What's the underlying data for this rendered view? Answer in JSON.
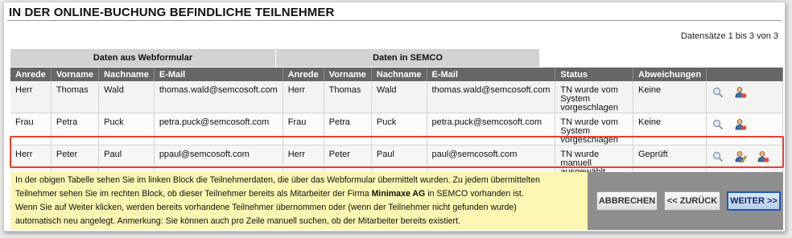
{
  "title": "IN DER ONLINE-BUCHUNG BEFINDLICHE TEILNEHMER",
  "records_info": "Datensätze 1 bis 3 von 3",
  "groups": {
    "webform": "Daten aus Webformular",
    "semco": "Daten in SEMCO"
  },
  "columns": [
    "Anrede",
    "Vorname",
    "Nachname",
    "E-Mail",
    "Anrede",
    "Vorname",
    "Nachname",
    "E-Mail",
    "Status",
    "Abweichungen",
    ""
  ],
  "rows": [
    {
      "web_anrede": "Herr",
      "web_vorname": "Thomas",
      "web_nachname": "Wald",
      "web_email": "thomas.wald@semcosoft.com",
      "semco_anrede": "Herr",
      "semco_vorname": "Thomas",
      "semco_nachname": "Wald",
      "semco_email": "thomas.wald@semcosoft.com",
      "status": "TN wurde vom System vorgeschlagen",
      "abweichungen": "Keine",
      "actions": [
        "magnifier-icon",
        "user-icon"
      ]
    },
    {
      "web_anrede": "Frau",
      "web_vorname": "Petra",
      "web_nachname": "Puck",
      "web_email": "petra.puck@semcosoft.com",
      "semco_anrede": "Frau",
      "semco_vorname": "Petra",
      "semco_nachname": "Puck",
      "semco_email": "petra.puck@semcosoft.com",
      "status": "TN wurde vom System vorgeschlagen",
      "abweichungen": "Keine",
      "actions": [
        "magnifier-icon",
        "user-icon"
      ]
    },
    {
      "web_anrede": "Herr",
      "web_vorname": "Peter",
      "web_nachname": "Paul",
      "web_email": "ppaul@semcosoft.com",
      "semco_anrede": "Herr",
      "semco_vorname": "Peter",
      "semco_nachname": "Paul",
      "semco_email": "paul@semcosoft.com",
      "status": "TN wurde manuell ausgewählt",
      "abweichungen": "Geprüft",
      "actions": [
        "magnifier-icon",
        "user-edit-icon",
        "user-icon"
      ]
    }
  ],
  "info": {
    "line1": "In der obigen Tabelle sehen Sie im linken Block die Teilnehmerdaten, die über das Webformular übermittelt wurden. Zu jedem übermittelten",
    "line2_pre": "Teilnehmer sehen Sie im rechten Block, ob dieser Teilnehmer bereits als Mitarbeiter der Firma ",
    "line2_company": "Minimaxe AG",
    "line2_post": " in SEMCO vorhanden ist.",
    "line3": "Wenn Sie auf Weiter klicken, werden bereits vorhandene Teilnehmer übernommen oder (wenn der Teilnehmer nicht gefunden wurde)",
    "line4": "automatisch neu angelegt. Anmerkung: Sie können auch pro Zeile manuell suchen, ob der Mitarbeiter bereits existiert."
  },
  "buttons": {
    "cancel": "ABBRECHEN",
    "back": "<< ZURÜCK",
    "next": "WEITER >>"
  },
  "colors": {
    "header": "#666666",
    "highlight": "#e8412c",
    "info_bg": "#fbf7b2",
    "button_panel": "#8e8e8e"
  }
}
